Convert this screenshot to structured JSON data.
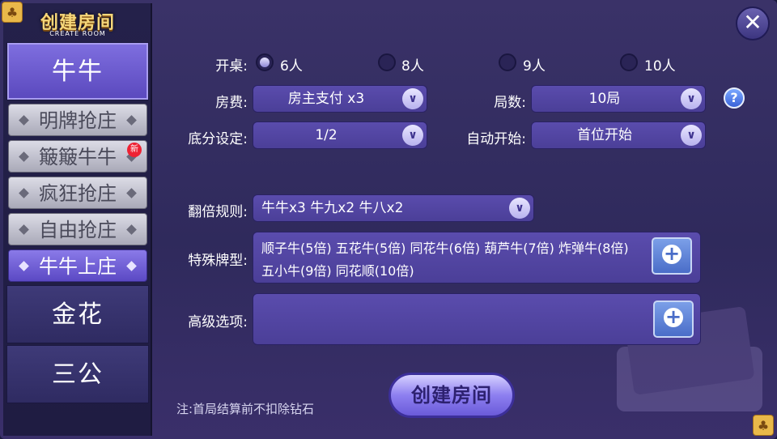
{
  "title": {
    "main": "创建房间",
    "sub": "CREATE ROOM"
  },
  "sidebar": {
    "tabs": [
      {
        "label": "牛牛"
      },
      {
        "label": "金花"
      },
      {
        "label": "三公"
      }
    ],
    "subtabs": [
      {
        "label": "明牌抢庄"
      },
      {
        "label": "簸簸牛牛",
        "badge": "新"
      },
      {
        "label": "疯狂抢庄"
      },
      {
        "label": "自由抢庄"
      },
      {
        "label": "牛牛上庄"
      }
    ]
  },
  "form": {
    "table_label": "开桌:",
    "players": [
      "6人",
      "8人",
      "9人",
      "10人"
    ],
    "fee_label": "房费:",
    "fee_value": "房主支付 x3",
    "rounds_label": "局数:",
    "rounds_value": "10局",
    "base_label": "底分设定:",
    "base_value": "1/2",
    "autostart_label": "自动开始:",
    "autostart_value": "首位开始",
    "double_label": "翻倍规则:",
    "double_value": "牛牛x3  牛九x2  牛八x2",
    "special_label": "特殊牌型:",
    "special_value": "顺子牛(5倍) 五花牛(5倍) 同花牛(6倍) 葫芦牛(7倍) 炸弹牛(8倍) 五小牛(9倍) 同花顺(10倍)",
    "advanced_label": "高级选项:",
    "create_label": "创建房间",
    "note": "注:首局结算前不扣除钻石"
  },
  "icons": {
    "close": "close-icon",
    "help": "help-icon"
  }
}
